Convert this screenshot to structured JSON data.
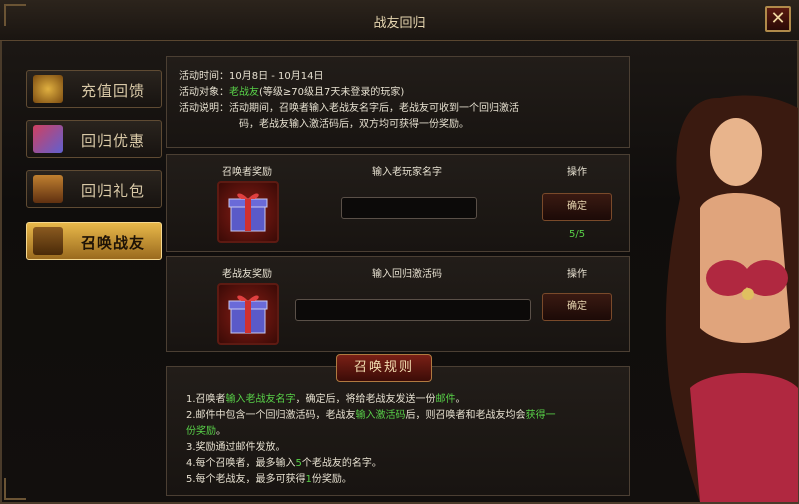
{
  "window": {
    "title": "战友回归",
    "close_glyph": "✕"
  },
  "sidebar": {
    "items": [
      {
        "label": "充值回馈",
        "icon": "money-bag-icon",
        "active": false
      },
      {
        "label": "回归优惠",
        "icon": "gift-box-icon",
        "active": false
      },
      {
        "label": "回归礼包",
        "icon": "treasure-chest-icon",
        "active": false
      },
      {
        "label": "召唤战友",
        "icon": "scroll-icon",
        "active": true
      }
    ]
  },
  "info": {
    "time_label": "活动时间：",
    "time_value": "10月8日 - 10月14日",
    "target_label": "活动对象：",
    "target_highlight": "老战友",
    "target_rest": "(等级≥70级且7天未登录的玩家)",
    "desc_label": "活动说明：",
    "desc_line1": "活动期间，召唤者输入老战友名字后，老战友可收到一个回归激活",
    "desc_line2": "码，老战友输入激活码后，双方均可获得一份奖励。"
  },
  "summoner": {
    "reward_header": "召唤者奖励",
    "input_header": "输入老玩家名字",
    "action_header": "操作",
    "input_value": "",
    "button_label": "确定",
    "count": "5/5"
  },
  "veteran": {
    "reward_header": "老战友奖励",
    "input_header": "输入回归激活码",
    "action_header": "操作",
    "input_value": "",
    "button_label": "确定"
  },
  "rules": {
    "title": "召唤规则",
    "lines": [
      {
        "parts": [
          "1.召唤者",
          "输入老战友名字",
          "，确定后，将给老战友发送一份",
          "邮件",
          "。"
        ]
      },
      {
        "parts": [
          "2.邮件中包含一个回归激活码，老战友",
          "输入激活码",
          "后，则召唤者和老战友均会",
          "获得一"
        ]
      },
      {
        "parts": [
          "份奖励",
          "。"
        ]
      },
      {
        "parts": [
          "3.奖励通过邮件发放。"
        ]
      },
      {
        "parts": [
          "4.每个召唤者，最多输入",
          "5",
          "个老战友的名字。"
        ]
      },
      {
        "parts": [
          "5.每个老战友，最多可获得",
          "1",
          "份奖励。"
        ]
      }
    ]
  },
  "colors": {
    "accent_gold": "#e8b84a",
    "highlight_green": "#58d048",
    "frame_border": "#4a3b2a"
  }
}
